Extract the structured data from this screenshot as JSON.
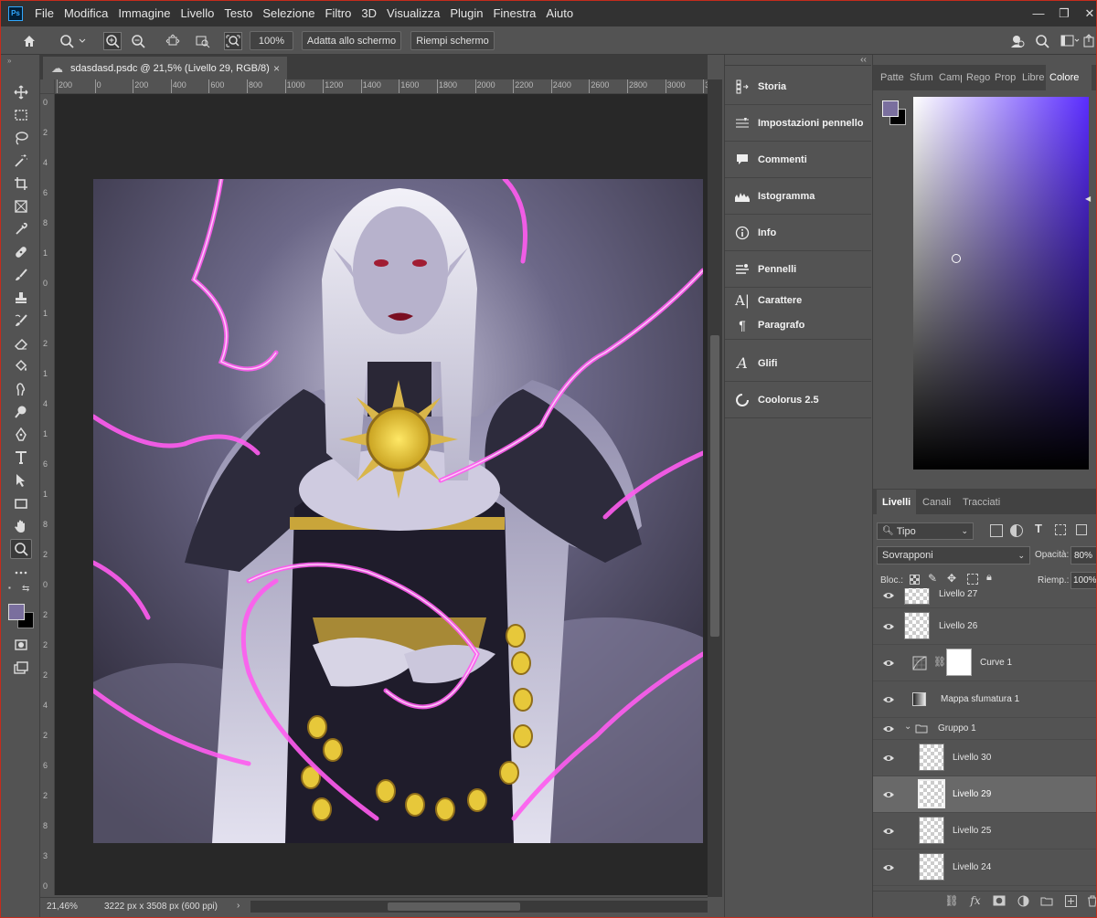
{
  "menubar": {
    "logo": "Ps",
    "items": [
      "File",
      "Modifica",
      "Immagine",
      "Livello",
      "Testo",
      "Selezione",
      "Filtro",
      "3D",
      "Visualizza",
      "Plugin",
      "Finestra",
      "Aiuto"
    ]
  },
  "options_bar": {
    "zoom_value": "100%",
    "fit_screen_label": "Adatta allo schermo",
    "fill_screen_label": "Riempi schermo"
  },
  "document": {
    "tab_title": "sdasdasd.psdc @ 21,5% (Livello 29, RGB/8)",
    "tab_close": "×",
    "ruler_h_ticks": [
      "200",
      "0",
      "200",
      "400",
      "600",
      "800",
      "1000",
      "1200",
      "1400",
      "1600",
      "1800",
      "2000",
      "2200",
      "2400",
      "2600",
      "2800",
      "3000",
      "32"
    ],
    "ruler_v_ticks": [
      "0",
      "2",
      "4",
      "6",
      "8",
      "1",
      "0",
      "1",
      "2",
      "1",
      "4",
      "1",
      "6",
      "1",
      "8",
      "2",
      "0",
      "2",
      "2",
      "2",
      "4",
      "2",
      "6",
      "2",
      "8",
      "3",
      "0"
    ],
    "status_zoom": "21,46%",
    "status_info": "3222 px x 3508 px (600 ppi)",
    "status_arrow": "›"
  },
  "mid_panel": {
    "collapse": "‹‹",
    "items": [
      {
        "label": "Storia",
        "icon": "history-icon"
      },
      {
        "label": "Impostazioni pennello",
        "icon": "brush-settings-icon"
      },
      {
        "label": "Commenti",
        "icon": "comment-icon"
      },
      {
        "label": "Istogramma",
        "icon": "histogram-icon"
      },
      {
        "label": "Info",
        "icon": "info-icon"
      },
      {
        "label": "Pennelli",
        "icon": "brushes-icon"
      },
      {
        "label": "Carattere",
        "icon": "character-icon"
      },
      {
        "label": "Paragrafo",
        "icon": "paragraph-icon"
      },
      {
        "label": "Glifi",
        "icon": "glyphs-icon"
      },
      {
        "label": "Coolorus 2.5",
        "icon": "coolorus-icon"
      }
    ]
  },
  "right_panel": {
    "collapse": "‹‹",
    "top_tabs": [
      "Patte",
      "Sfum",
      "Camp",
      "Rego",
      "Prop",
      "Libre",
      "Colore"
    ],
    "active_top_tab": "Colore",
    "colors": {
      "foreground": "#7a6f9e",
      "background": "#000000",
      "picker_hue": "#5a2cff"
    },
    "layer_tabs": [
      "Livelli",
      "Canali",
      "Tracciati"
    ],
    "kind_filter": "Tipo",
    "blend_mode": "Sovrapponi",
    "opacity_label": "Opacità:",
    "opacity_value": "80%",
    "lock_label": "Bloc.:",
    "fill_label": "Riemp.:",
    "fill_value": "100%",
    "layers": [
      {
        "name": "Livello 27",
        "type": "pixel"
      },
      {
        "name": "Livello 26",
        "type": "pixel"
      },
      {
        "name": "Curve 1",
        "type": "adjustment"
      },
      {
        "name": "Mappa sfumatura 1",
        "type": "gradient-map"
      },
      {
        "name": "Gruppo 1",
        "type": "group"
      },
      {
        "name": "Livello 30",
        "type": "pixel"
      },
      {
        "name": "Livello 29",
        "type": "pixel",
        "selected": true
      },
      {
        "name": "Livello 25",
        "type": "pixel"
      },
      {
        "name": "Livello 24",
        "type": "pixel"
      }
    ],
    "bottom_icons": [
      "link-icon",
      "fx-icon",
      "mask-icon",
      "adjustment-icon",
      "folder-icon",
      "new-layer-icon",
      "trash-icon"
    ],
    "fx_label": "fx"
  }
}
